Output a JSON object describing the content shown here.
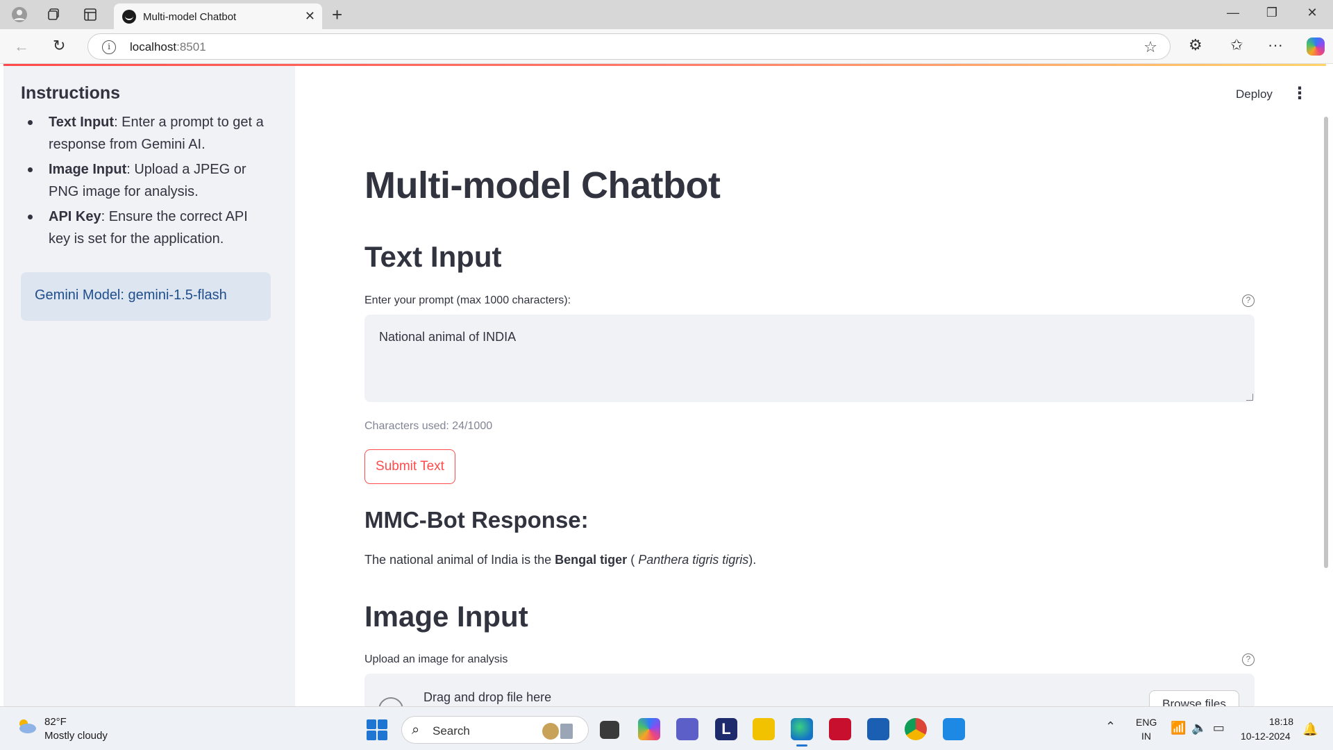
{
  "browser": {
    "tab_title": "Multi-model Chatbot",
    "url_host": "localhost",
    "url_port": ":8501"
  },
  "app": {
    "deploy_label": "Deploy",
    "title": "Multi-model Chatbot",
    "text_input_heading": "Text Input",
    "prompt_label": "Enter your prompt (max 1000 characters):",
    "prompt_value": "National animal of INDIA",
    "char_count": "Characters used: 24/1000",
    "submit_label": "Submit Text",
    "response_heading": "MMC-Bot Response:",
    "response": {
      "prefix": "The national animal of India is the ",
      "bold": "Bengal tiger",
      "middle": " ( ",
      "italic": "Panthera tigris tigris",
      "suffix": ")."
    },
    "image_input_heading": "Image Input",
    "upload_label": "Upload an image for analysis",
    "drop_text": "Drag and drop file here",
    "browse_label": "Browse files"
  },
  "sidebar": {
    "heading": "Instructions",
    "items": [
      {
        "term": "Text Input",
        "desc": ": Enter a prompt to get a response from Gemini AI."
      },
      {
        "term": "Image Input",
        "desc": ": Upload a JPEG or PNG image for analysis."
      },
      {
        "term": "API Key",
        "desc": ": Ensure the correct API key is set for the application."
      }
    ],
    "model_info": "Gemini Model: gemini-1.5-flash"
  },
  "taskbar": {
    "weather_temp": "82°F",
    "weather_desc": "Mostly cloudy",
    "search_label": "Search",
    "lang_line1": "ENG",
    "lang_line2": "IN",
    "time": "18:18",
    "date": "10-12-2024"
  },
  "colors": {
    "accent": "#ff4b4b",
    "sidebar_bg": "#f0f2f6",
    "info_bg": "#dde5f0",
    "info_text": "#1f4e8c",
    "text": "#31333f"
  }
}
